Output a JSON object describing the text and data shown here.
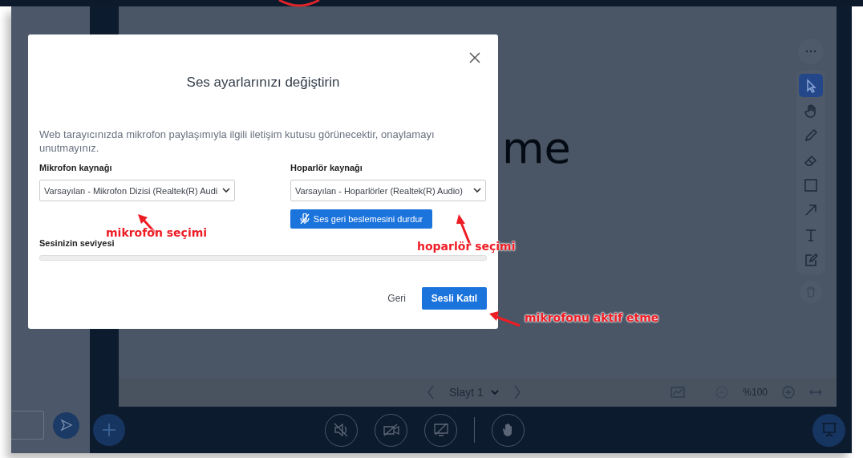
{
  "slide": {
    "text": "me",
    "page_selector": "Slayt 1",
    "zoom": "%100"
  },
  "tools": [
    {
      "kind": "select",
      "selected": true
    },
    {
      "kind": "hand",
      "selected": false
    },
    {
      "kind": "pencil",
      "selected": false
    },
    {
      "kind": "eraser",
      "selected": false
    },
    {
      "kind": "rectangle",
      "selected": false
    },
    {
      "kind": "arrow",
      "selected": false
    },
    {
      "kind": "text",
      "selected": false
    },
    {
      "kind": "note",
      "selected": false
    }
  ],
  "dialog": {
    "title": "Ses ayarlarınızı değiştirin",
    "message": "Web tarayıcınızda mikrofon paylaşımıyla ilgili iletişim kutusu görünecektir, onaylamayı unutmayınız.",
    "microphone": {
      "label": "Mikrofon kaynağı",
      "value": "Varsayılan - Mikrofon Dizisi (Realtek(R) Audi"
    },
    "speaker": {
      "label": "Hoparlör kaynağı",
      "value": "Varsayılan - Hoparlörler (Realtek(R) Audio)"
    },
    "feedback_button": "Ses geri beslemesini durdur",
    "volume": {
      "label": "Sesinizin seviyesi"
    },
    "buttons": [
      {
        "kind": "link",
        "label": "Geri"
      },
      {
        "kind": "primary",
        "label": "Sesli Katıl"
      }
    ]
  },
  "annotations": [
    {
      "kind": "microphone",
      "text": "mikrofon seçimi"
    },
    {
      "kind": "speaker",
      "text": "hoparlör seçimi"
    },
    {
      "kind": "join",
      "text": "mikrofonu aktif etme"
    }
  ]
}
